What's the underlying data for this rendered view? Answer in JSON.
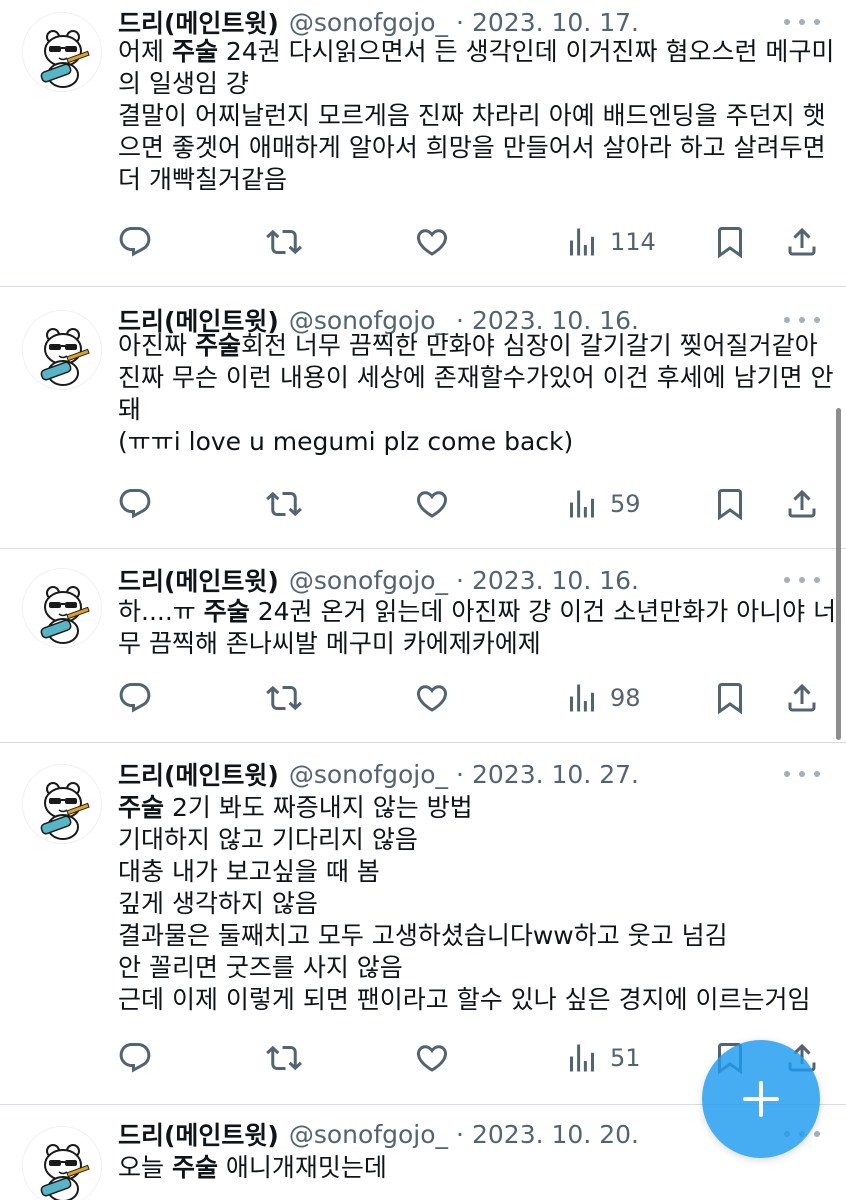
{
  "tweets": [
    {
      "name": "드리(메인트윗)",
      "handle": "@sonofgojo_",
      "separator": "·",
      "date": "2023. 10. 17.",
      "lines": [
        {
          "pre": "어제 ",
          "kw": "주술",
          "post": " 24권 다시읽으면서 든 생각인데 이거진짜 혐오스런 메구미"
        },
        {
          "pre": "의 일생임 걍",
          "kw": "",
          "post": ""
        },
        {
          "pre": "결말이 어찌날런지 모르게음 진짜 차라리 아예 배드엔딩을 주던지 햇",
          "kw": "",
          "post": ""
        },
        {
          "pre": "으면 좋겟어 애매하게 알아서 희망을 만들어서 살아라 하고 살려두면",
          "kw": "",
          "post": ""
        },
        {
          "pre": "더 개빡칠거같음",
          "kw": "",
          "post": ""
        }
      ],
      "views": "114"
    },
    {
      "name": "드리(메인트윗)",
      "handle": "@sonofgojo_",
      "separator": "·",
      "date": "2023. 10. 16.",
      "lines": [
        {
          "pre": "아진짜 ",
          "kw": "주술",
          "post": "회전 너무 끔찍한 만화야 심장이 갈기갈기 찢어질거같아"
        },
        {
          "pre": "진짜 무슨 이런 내용이 세상에 존재할수가있어 이건 후세에 남기면 안",
          "kw": "",
          "post": ""
        },
        {
          "pre": "돼",
          "kw": "",
          "post": ""
        },
        {
          "pre": "(ㅠㅠi love u megumi plz come back)",
          "kw": "",
          "post": ""
        }
      ],
      "views": "59"
    },
    {
      "name": "드리(메인트윗)",
      "handle": "@sonofgojo_",
      "separator": "·",
      "date": "2023. 10. 16.",
      "lines": [
        {
          "pre": "하....ㅠ ",
          "kw": "주술",
          "post": " 24권 온거 읽는데 아진짜 걍 이건 소년만화가 아니야 너"
        },
        {
          "pre": "무 끔찍해 존나씨발 메구미 카에제카에제",
          "kw": "",
          "post": ""
        }
      ],
      "views": "98"
    },
    {
      "name": "드리(메인트윗)",
      "handle": "@sonofgojo_",
      "separator": "·",
      "date": "2023. 10. 27.",
      "lines": [
        {
          "pre": "",
          "kw": "주술",
          "post": " 2기 봐도 짜증내지 않는 방법"
        },
        {
          "pre": "기대하지 않고 기다리지 않음",
          "kw": "",
          "post": ""
        },
        {
          "pre": "대충 내가 보고싶을 때 봄",
          "kw": "",
          "post": ""
        },
        {
          "pre": "깊게 생각하지 않음",
          "kw": "",
          "post": ""
        },
        {
          "pre": "결과물은 둘째치고 모두 고생하셨습니다ww하고 웃고 넘김",
          "kw": "",
          "post": ""
        },
        {
          "pre": "안 꼴리면 굿즈를 사지 않음",
          "kw": "",
          "post": ""
        },
        {
          "pre": "근데 이제 이렇게 되면 팬이라고 할수 있나 싶은 경지에 이르는거임",
          "kw": "",
          "post": ""
        }
      ],
      "views": "51"
    },
    {
      "name": "드리(메인트윗)",
      "handle": "@sonofgojo_",
      "separator": "·",
      "date": "2023. 10. 20.",
      "lines": [
        {
          "pre": "오늘 ",
          "kw": "주술",
          "post": " 애니개재밋는데"
        }
      ],
      "views": ""
    }
  ],
  "icons": [
    "reply-icon",
    "retweet-icon",
    "like-icon",
    "views-icon",
    "bookmark-icon",
    "share-icon",
    "more-icon",
    "compose-icon"
  ],
  "colors": {
    "text": "#0f1419",
    "secondary": "#536471",
    "accent": "#1d9bf0",
    "divider": "#d7dde2"
  }
}
